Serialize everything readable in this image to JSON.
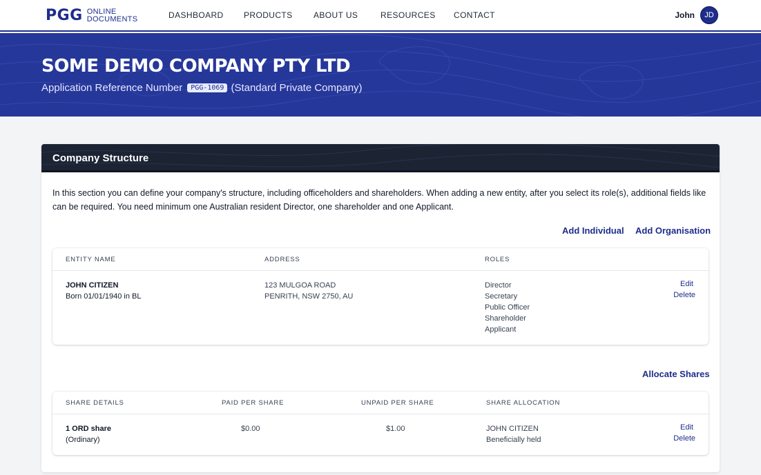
{
  "nav": {
    "logo_mark": "PGG",
    "logo_line1": "ONLINE",
    "logo_line2": "DOCUMENTS",
    "links": [
      "DASHBOARD",
      "PRODUCTS",
      "ABOUT US",
      "RESOURCES",
      "CONTACT"
    ],
    "user_name": "John",
    "user_initials": "JD"
  },
  "hero": {
    "company_name": "SOME DEMO COMPANY PTY LTD",
    "ref_label": "Application Reference Number",
    "ref_number": "PGG-1069",
    "company_type": "(Standard Private Company)"
  },
  "structure": {
    "title": "Company Structure",
    "intro": "In this section you can define your company's structure, including officeholders and shareholders. When adding a new entity, after you select its role(s), additional fields like can be required. You need minimum one Australian resident Director, one shareholder and one Applicant.",
    "add_individual": "Add Individual",
    "add_organisation": "Add Organisation",
    "entities": {
      "headers": [
        "ENTITY NAME",
        "ADDRESS",
        "ROLES"
      ],
      "rows": [
        {
          "name": "JOHN CITIZEN",
          "born": "Born 01/01/1940 in BL",
          "address_line1": "123 MULGOA ROAD",
          "address_line2": "PENRITH, NSW 2750, AU",
          "roles": [
            "Director",
            "Secretary",
            "Public Officer",
            "Shareholder",
            "Applicant"
          ],
          "edit": "Edit",
          "delete": "Delete"
        }
      ]
    },
    "allocate_shares": "Allocate Shares",
    "shares": {
      "headers": [
        "SHARE DETAILS",
        "PAID PER SHARE",
        "UNPAID PER SHARE",
        "SHARE ALLOCATION"
      ],
      "rows": [
        {
          "detail_line1": "1 ORD share",
          "detail_line2": "(Ordinary)",
          "paid": "$0.00",
          "unpaid": "$1.00",
          "holder": "JOHN CITIZEN",
          "holding": "Beneficially held",
          "edit": "Edit",
          "delete": "Delete"
        }
      ]
    }
  },
  "colors": {
    "brand": "#1e2d8c",
    "hero_bg": "#26379a",
    "card_header_bg": "#1c2434"
  }
}
